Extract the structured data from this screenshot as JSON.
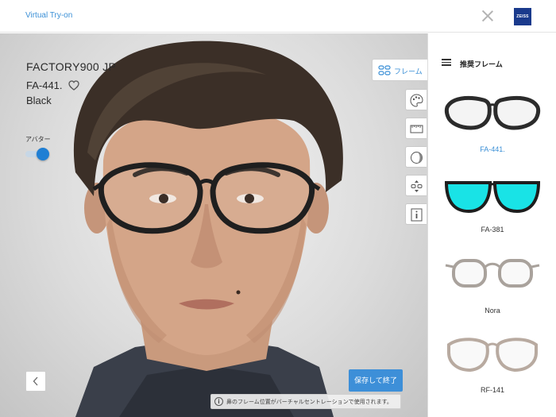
{
  "header": {
    "app_title": "Virtual Try-on",
    "logo_text": "ZEISS",
    "close_icon": "close-icon"
  },
  "frame": {
    "brand": "FACTORY900 JP",
    "model": "FA-441.",
    "color": "Black",
    "favorite_icon": "heart-icon"
  },
  "avatar_toggle": {
    "label": "アバター",
    "enabled": true
  },
  "toolbar": {
    "frame_tab_label": "フレーム",
    "frame_tab_icon": "glasses-grid-icon",
    "tools": [
      {
        "name": "palette-icon"
      },
      {
        "name": "ruler-icon"
      },
      {
        "name": "lens-icon"
      },
      {
        "name": "adjust-position-icon"
      },
      {
        "name": "info-icon"
      }
    ]
  },
  "footer": {
    "back_icon": "chevron-left-icon",
    "save_label": "保存して終了",
    "notice": "鼻のフレーム位置がバーチャルセントレーションで使用されます。"
  },
  "sidebar": {
    "title": "推奨フレーム",
    "menu_icon": "hamburger-icon",
    "items": [
      {
        "name": "FA-441.",
        "selected": true,
        "frame_color": "#2b2b2b",
        "lens_color": "none"
      },
      {
        "name": "FA-381",
        "selected": false,
        "frame_color": "#1e1e1e",
        "lens_color": "#19e3e6"
      },
      {
        "name": "Nora",
        "selected": false,
        "frame_color": "#a9a29c",
        "lens_color": "none"
      },
      {
        "name": "RF-141",
        "selected": false,
        "frame_color": "#b8aaa0",
        "lens_color": "none"
      }
    ]
  },
  "colors": {
    "accent": "#3a8fd6",
    "save_button": "#3d8fd8",
    "logo_bg": "#1a3a8c"
  }
}
